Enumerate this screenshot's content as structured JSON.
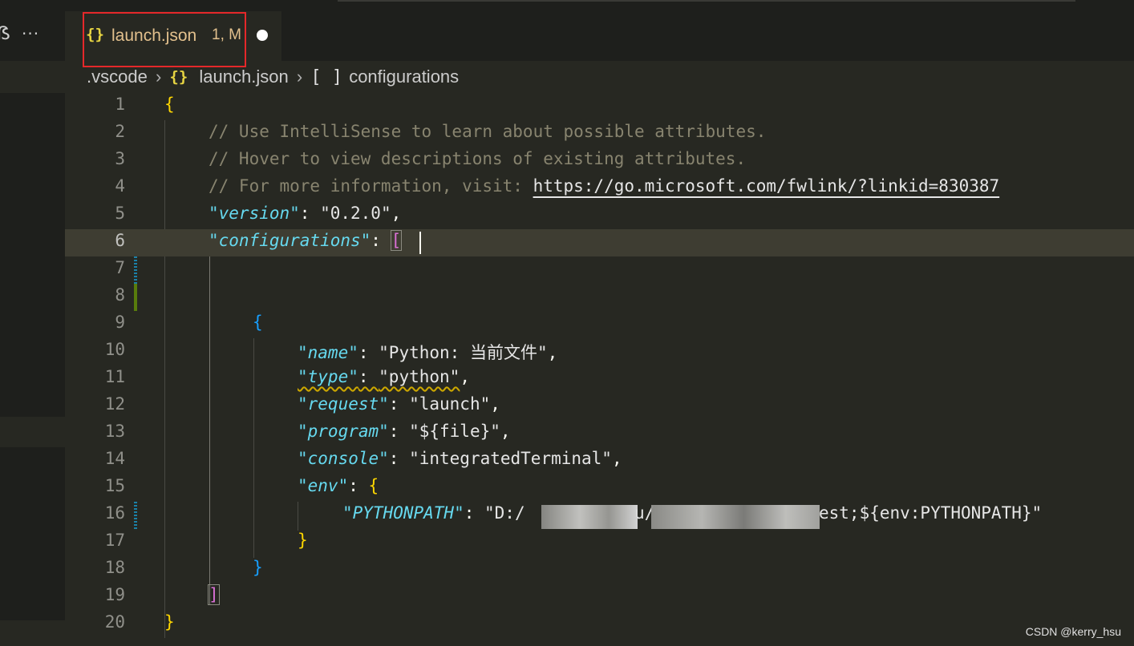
{
  "sidebar": {
    "partial_icon": "ẞ",
    "more_label": "···"
  },
  "tab": {
    "icon": "{}",
    "label": "launch.json",
    "status": "1, M"
  },
  "breadcrumb": {
    "folder": ".vscode",
    "file_icon": "{}",
    "file": "launch.json",
    "symbol_icon": "[ ]",
    "symbol": "configurations"
  },
  "editor": {
    "line_numbers": [
      "1",
      "2",
      "3",
      "4",
      "5",
      "6",
      "7",
      "8",
      "9",
      "10",
      "11",
      "12",
      "13",
      "14",
      "15",
      "16",
      "17",
      "18",
      "19",
      "20"
    ],
    "current_line": 6,
    "lines": {
      "l1_open": "{",
      "l2_comment": "// Use IntelliSense to learn about possible attributes.",
      "l3_comment": "// Hover to view descriptions of existing attributes.",
      "l4_comment_prefix": "// For more information, visit: ",
      "l4_link": "https://go.microsoft.com/fwlink/?linkid=830387",
      "l5_key": "\"version\"",
      "l5_val": "\"0.2.0\"",
      "l6_key": "\"configurations\"",
      "l6_bracket": "[",
      "l9_open": "{",
      "l10_key": "\"name\"",
      "l10_val": "\"Python: 当前文件\"",
      "l11_key": "\"type\"",
      "l11_val": "\"python\"",
      "l12_key": "\"request\"",
      "l12_val": "\"launch\"",
      "l13_key": "\"program\"",
      "l13_val": "\"${file}\"",
      "l14_key": "\"console\"",
      "l14_val": "\"integratedTerminal\"",
      "l15_key": "\"env\"",
      "l15_open": "{",
      "l16_key": "\"PYTHONPATH\"",
      "l16_val_a": "\"D:/",
      "l16_val_b": "u/",
      "l16_val_c": "est;${env:PYTHONPATH}\"",
      "l17_close": "}",
      "l18_close": "}",
      "l19_close": "]",
      "l20_close": "}"
    }
  },
  "watermark": "CSDN @kerry_hsu",
  "colors": {
    "background": "#272822",
    "tab_highlight": "#e5282a",
    "key": "#66d9ef",
    "comment": "#88846f"
  }
}
